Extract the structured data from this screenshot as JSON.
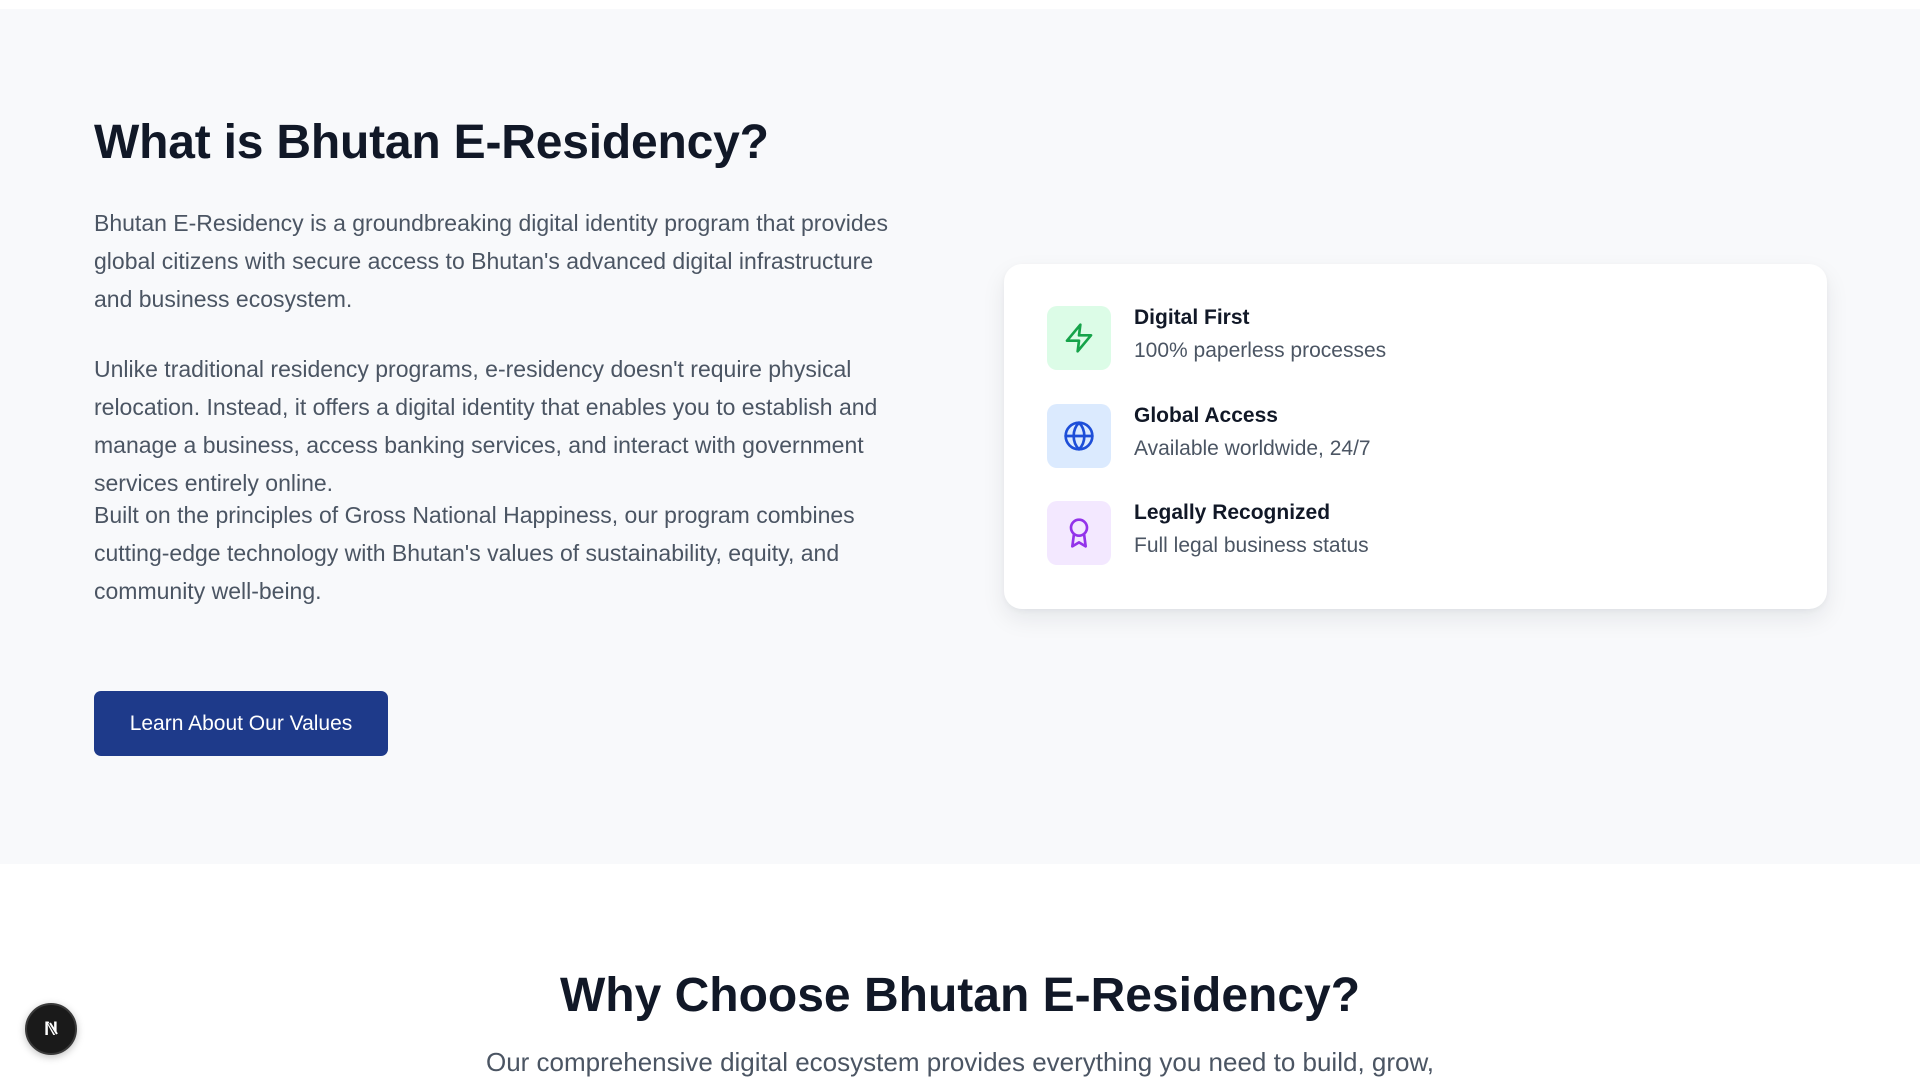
{
  "about": {
    "title": "What is Bhutan E-Residency?",
    "paragraphs": [
      "Bhutan E-Residency is a groundbreaking digital identity program that provides global citizens with secure access to Bhutan's advanced digital infrastructure and business ecosystem.",
      "Unlike traditional residency programs, e-residency doesn't require physical relocation. Instead, it offers a digital identity that enables you to establish and manage a business, access banking services, and interact with government services entirely online.",
      "Built on the principles of Gross National Happiness, our program combines cutting-edge technology with Bhutan's values of sustainability, equity, and community well-being."
    ],
    "cta_label": "Learn About Our Values"
  },
  "features": [
    {
      "icon": "lightning-icon",
      "title": "Digital First",
      "description": "100% paperless processes",
      "icon_color": "#16a34a",
      "icon_bg": "#dcfce7"
    },
    {
      "icon": "globe-icon",
      "title": "Global Access",
      "description": "Available worldwide, 24/7",
      "icon_color": "#1d4ed8",
      "icon_bg": "#dbeafe"
    },
    {
      "icon": "award-icon",
      "title": "Legally Recognized",
      "description": "Full legal business status",
      "icon_color": "#9333ea",
      "icon_bg": "#f3e8ff"
    }
  ],
  "why": {
    "title": "Why Choose Bhutan E-Residency?",
    "subtitle": "Our comprehensive digital ecosystem provides everything you need to build, grow,"
  },
  "dev_badge": {
    "icon": "nextjs-logo-icon",
    "letter": "N"
  },
  "colors": {
    "primary": "#1e3a8a",
    "heading": "#111827",
    "body_text": "#4b5563",
    "section_bg": "#f8f9fb"
  }
}
